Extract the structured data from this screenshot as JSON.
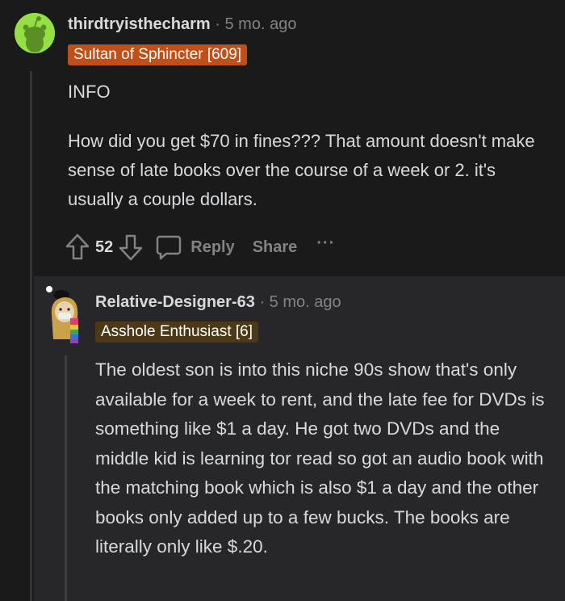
{
  "comment1": {
    "username": "thirdtryisthecharm",
    "time": "· 5 mo. ago",
    "flair": "Sultan of Sphincter [609]",
    "body_info": "INFO",
    "body_question": "How did you get $70 in fines??? That amount doesn't make sense of late books over the course of a week or 2. it's usually a couple dollars.",
    "votes": "52",
    "reply_label": "Reply",
    "share_label": "Share",
    "more_label": "···"
  },
  "comment2": {
    "username": "Relative-Designer-63",
    "time": "· 5 mo. ago",
    "flair": "Asshole Enthusiast [6]",
    "body": "The oldest son is into this niche 90s show that's only available for a week to rent, and the late fee for DVDs is something like $1 a day. He got two DVDs and the middle kid is learning tor read so got an audio book with the matching book which is also $1 a day and the other books only added up to a few bucks. The books are literally only like $.20."
  },
  "colors": {
    "background": "#1a1a1b",
    "reply_background": "#272729",
    "flair1": "#c0501a",
    "flair2": "#4c3a17",
    "snoo_avatar": "#94e044"
  }
}
